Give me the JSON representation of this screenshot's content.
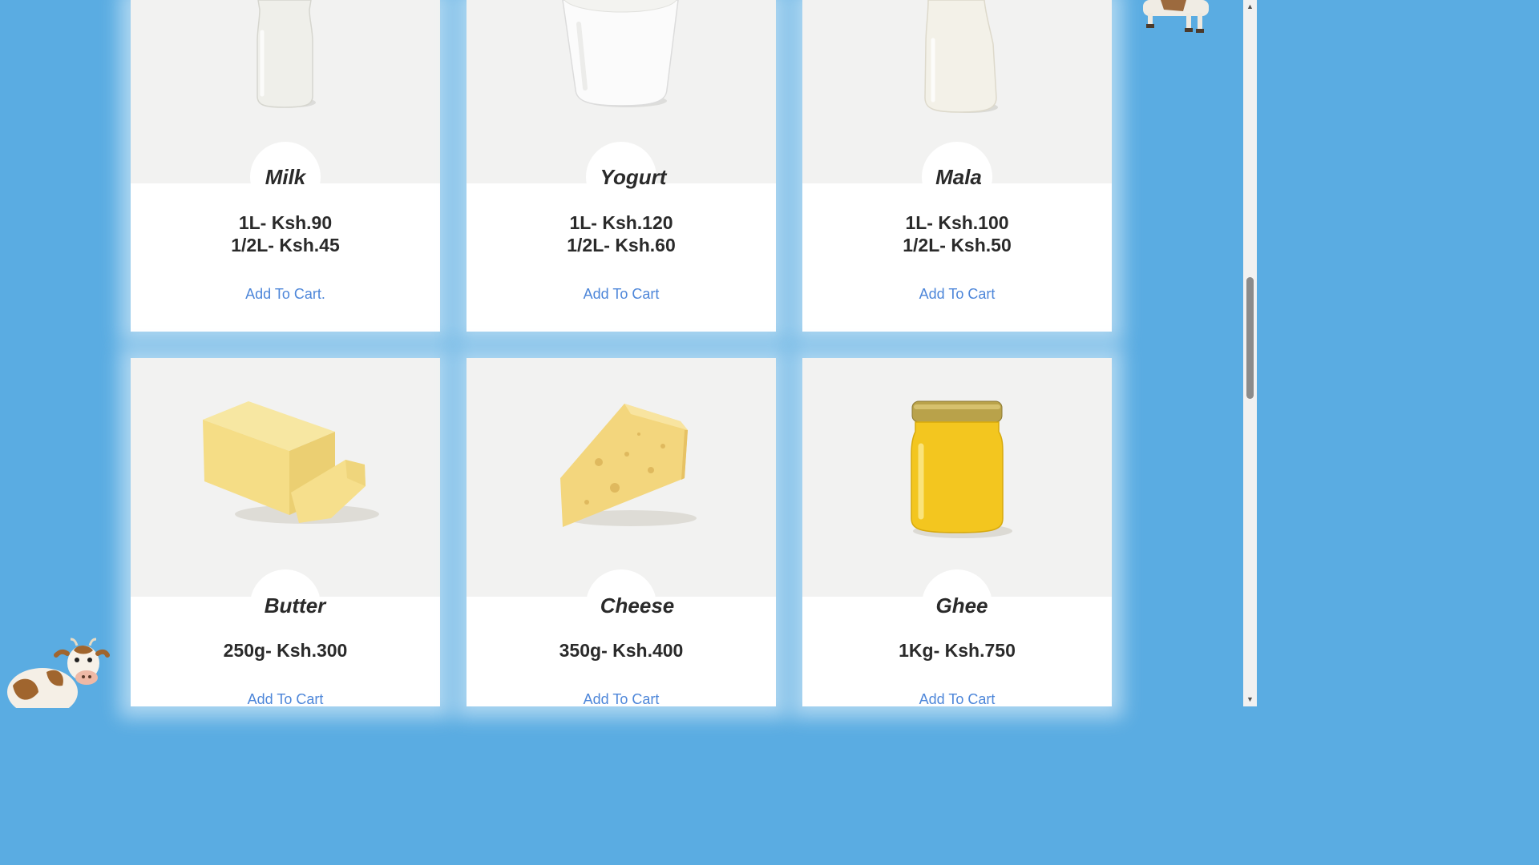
{
  "products": [
    {
      "name": "Milk",
      "price_line1": "1L- Ksh.90",
      "price_line2": "1/2L- Ksh.45",
      "cart_label": "Add To Cart."
    },
    {
      "name": "Yogurt",
      "price_line1": "1L- Ksh.120",
      "price_line2": "1/2L- Ksh.60",
      "cart_label": "Add To Cart"
    },
    {
      "name": "Mala",
      "price_line1": "1L- Ksh.100",
      "price_line2": "1/2L- Ksh.50",
      "cart_label": "Add To Cart"
    },
    {
      "name": "Butter",
      "price_line1": "250g- Ksh.300",
      "cart_label": "Add To Cart"
    },
    {
      "name": "Cheese",
      "price_line1": "350g- Ksh.400",
      "cart_label": "Add To Cart"
    },
    {
      "name": "Ghee",
      "price_line1": "1Kg- Ksh.750",
      "cart_label": "Add To Cart"
    }
  ],
  "icons": {
    "milk": "milk-bottle-image",
    "yogurt": "yogurt-cup-image",
    "mala": "mala-bottle-image",
    "butter": "butter-block-image",
    "cheese": "cheese-wedge-image",
    "ghee": "ghee-jar-image",
    "cow": "cow-mascot-image"
  },
  "colors": {
    "background": "#5aace2",
    "link": "#4d86d9",
    "card": "#ffffff",
    "image_bg": "#f2f2f1"
  }
}
